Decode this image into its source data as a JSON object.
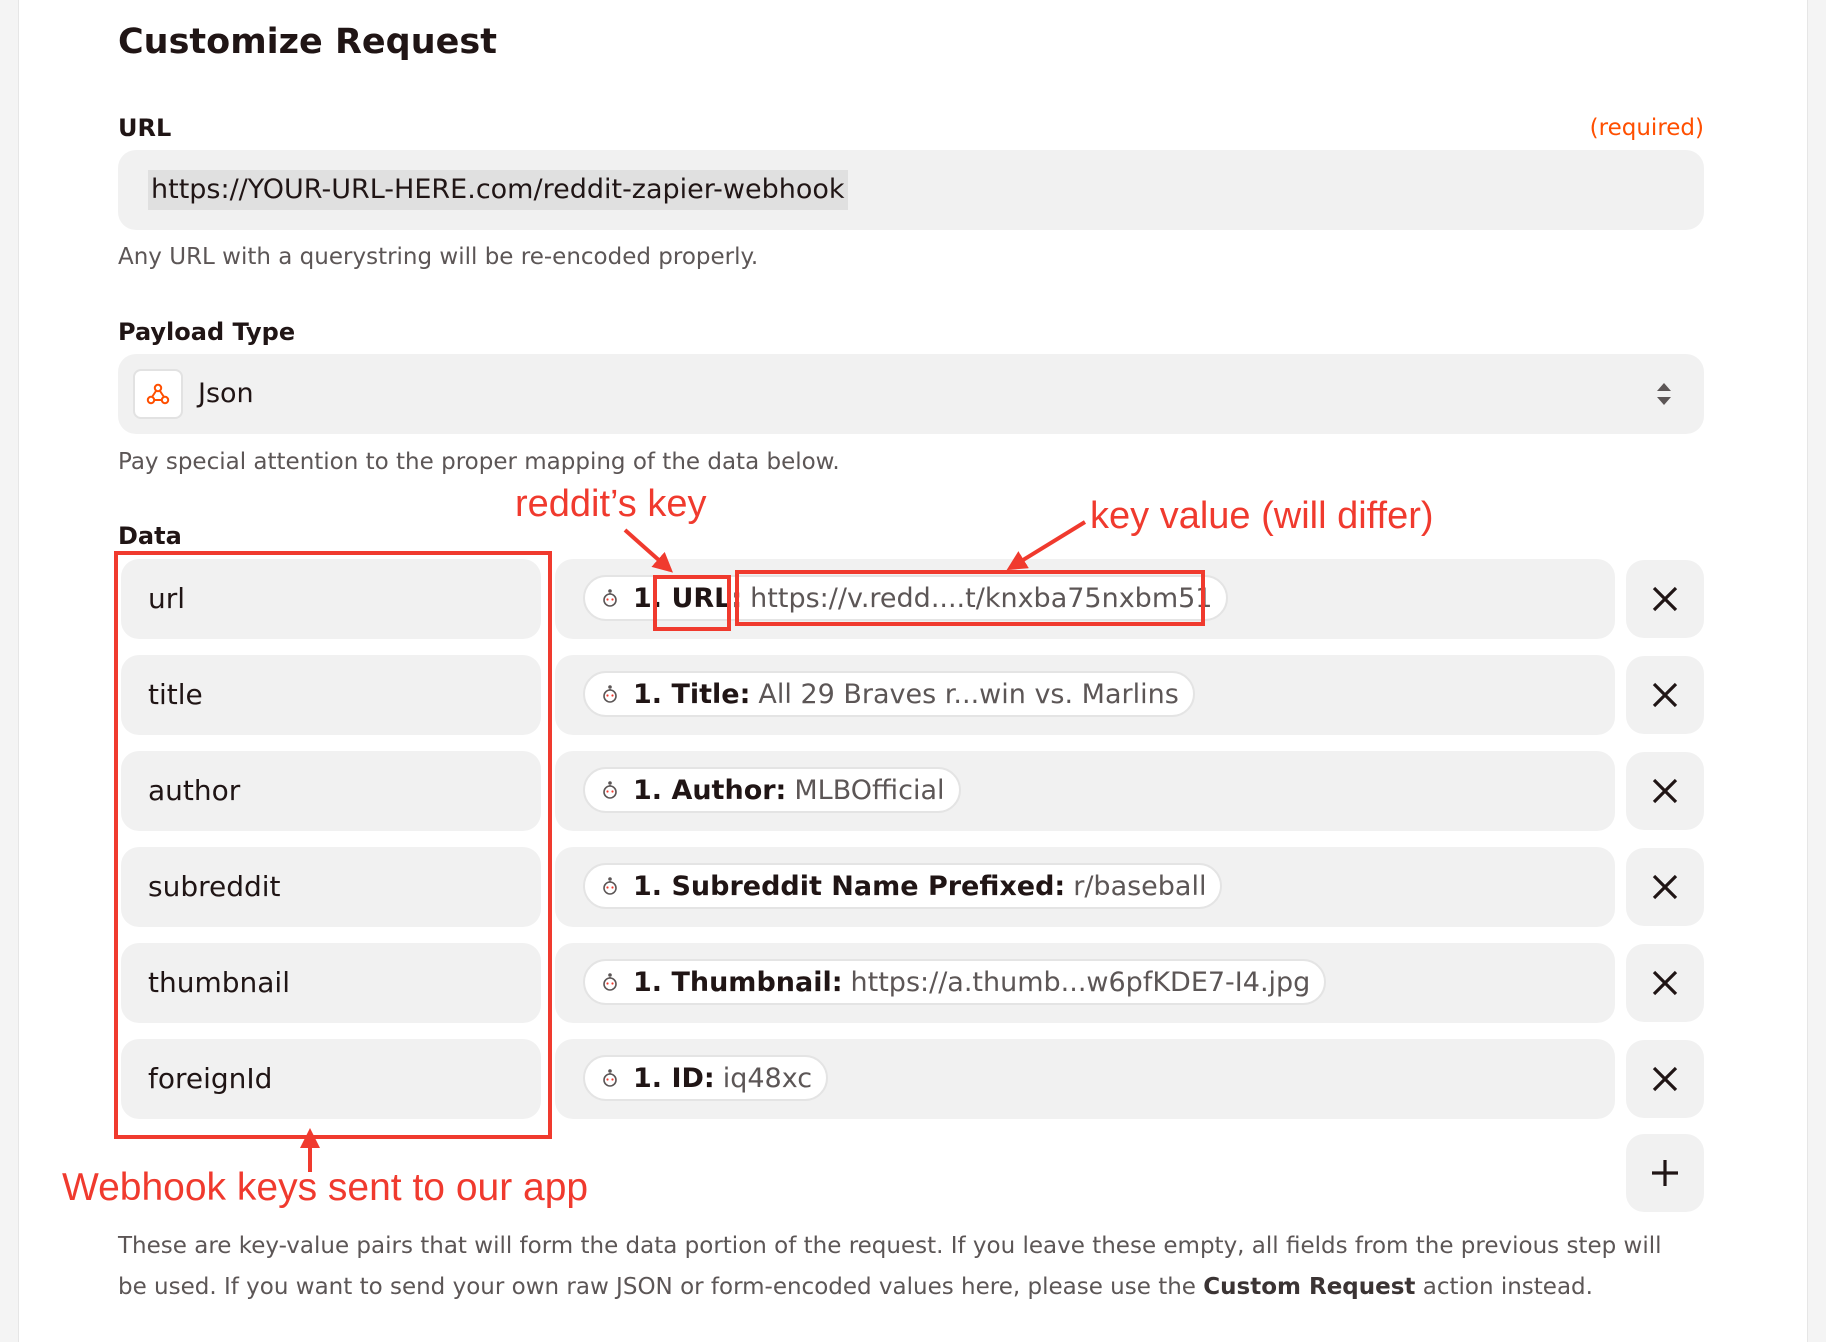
{
  "title": "Customize Request",
  "url_field": {
    "label": "URL",
    "required": "(required)",
    "value": "https://YOUR-URL-HERE.com/reddit-zapier-webhook",
    "help": "Any URL with a querystring will be re-encoded properly."
  },
  "payload_type": {
    "label": "Payload Type",
    "value": "Json",
    "help": "Pay special attention to the proper mapping of the data below."
  },
  "data": {
    "label": "Data",
    "rows": [
      {
        "key": "url",
        "pill_key": "1. URL:",
        "pill_value": "https://v.redd....t/knxba75nxbm51"
      },
      {
        "key": "title",
        "pill_key": "1. Title:",
        "pill_value": "All 29 Braves r...win vs. Marlins"
      },
      {
        "key": "author",
        "pill_key": "1. Author:",
        "pill_value": "MLBOfficial"
      },
      {
        "key": "subreddit",
        "pill_key": "1. Subreddit Name Prefixed:",
        "pill_value": "r/baseball"
      },
      {
        "key": "thumbnail",
        "pill_key": "1. Thumbnail:",
        "pill_value": "https://a.thumb...w6pfKDE7-I4.jpg"
      },
      {
        "key": "foreignId",
        "pill_key": "1. ID:",
        "pill_value": "iq48xc"
      }
    ],
    "help_pre": "These are key-value pairs that will form the data portion of the request. If you leave these empty, all fields from the previous step will be used. If you want to send your own raw JSON or form-encoded values here, please use the ",
    "help_bold": "Custom Request",
    "help_post": " action instead."
  },
  "annotations": {
    "reddit_key": "reddit’s key",
    "key_value": "key value (will differ)",
    "webhook_keys": "Webhook keys sent to our app"
  },
  "icons": {
    "payload": "webhook-icon",
    "row_source": "reddit-icon",
    "remove": "close-icon",
    "add": "plus-icon",
    "select": "updown-arrows-icon"
  },
  "colors": {
    "accent": "#ff4f00",
    "annotation": "#f03a2e",
    "field_bg": "#f1f1f1"
  }
}
